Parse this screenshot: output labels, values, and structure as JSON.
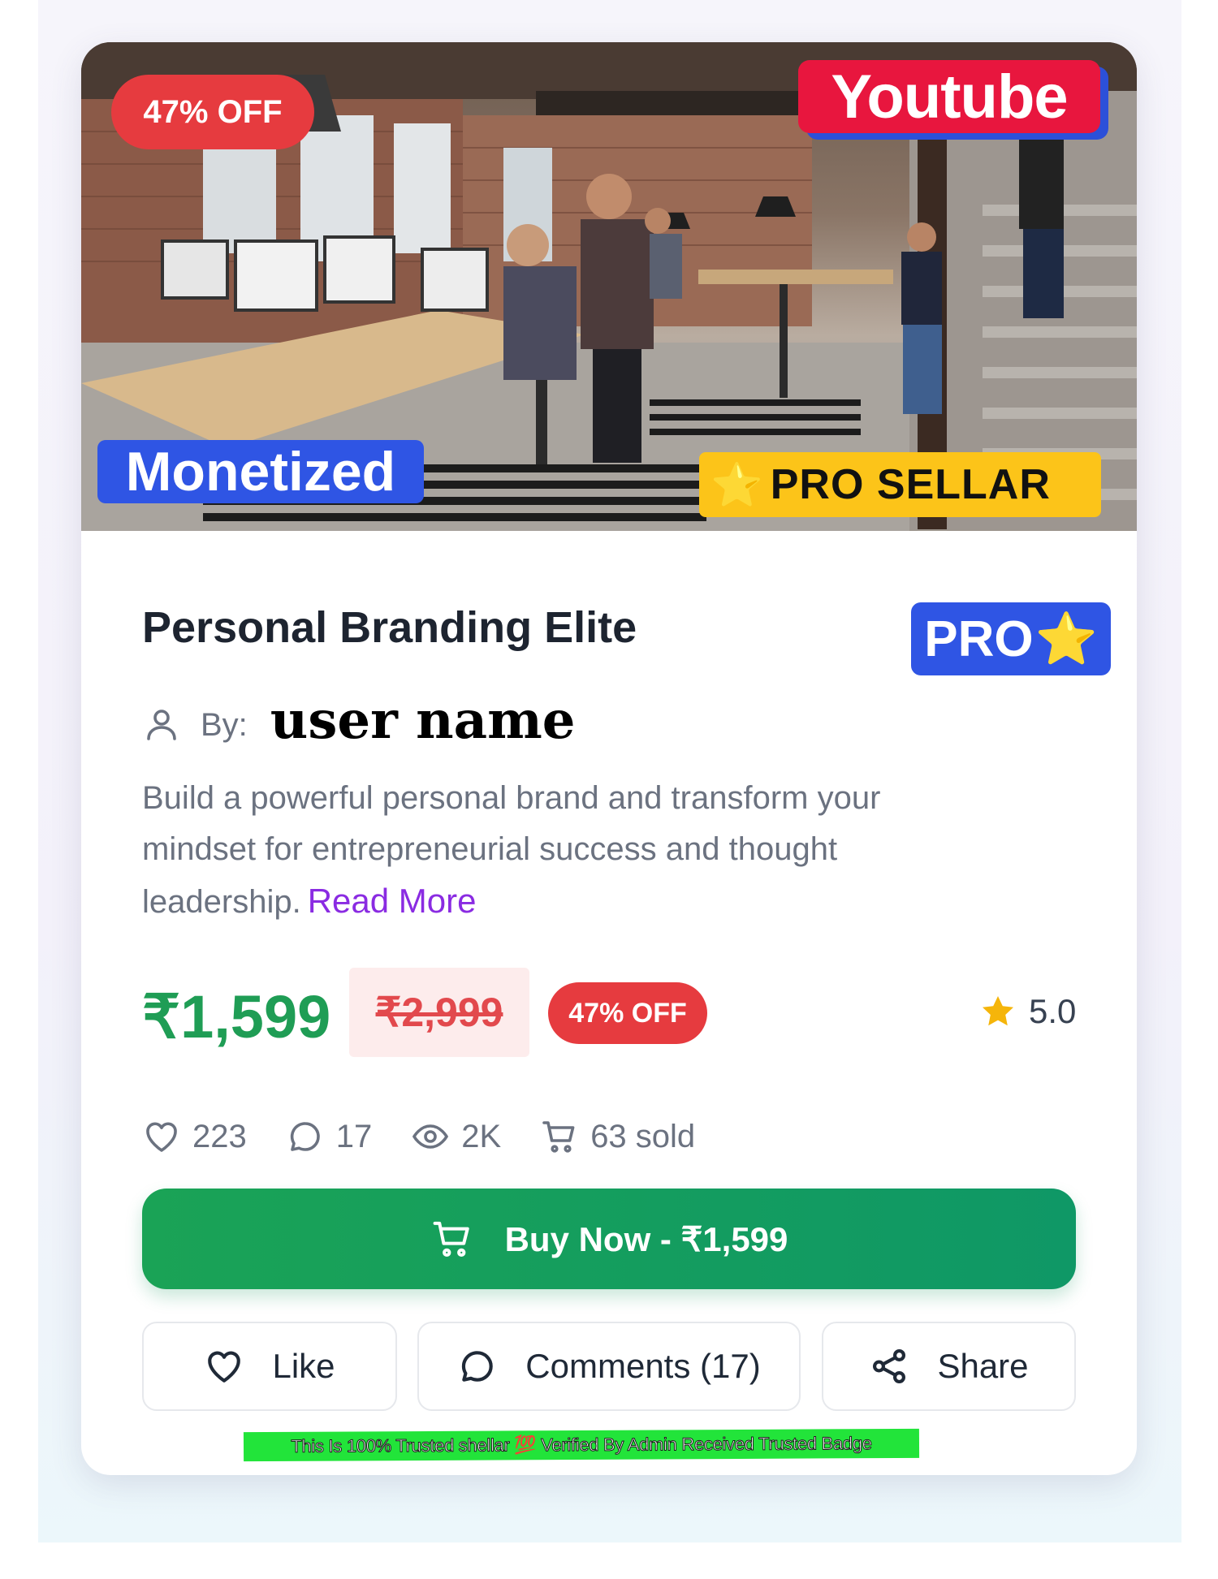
{
  "hero": {
    "discount_badge": "47% OFF",
    "youtube_badge": "Youtube",
    "monetized_badge": "Monetized",
    "pro_seller_star": "⭐",
    "pro_seller_badge": "PRO SELLAR"
  },
  "product": {
    "title": "Personal Branding Elite",
    "pro_badge": "PRO",
    "pro_badge_star": "⭐",
    "by_label": "By:",
    "author": "user name",
    "description": "Build a powerful personal brand and transform your mindset for entrepreneurial success and thought leadership.",
    "read_more": "Read More"
  },
  "pricing": {
    "current_price": "₹1,599",
    "original_price": "₹2,999",
    "discount": "47% OFF",
    "rating": "5.0"
  },
  "stats": {
    "likes": "223",
    "comments": "17",
    "views": "2K",
    "sold": "63 sold"
  },
  "actions": {
    "buy_now": "Buy Now - ₹1,599",
    "like": "Like",
    "comments": "Comments (17)",
    "share": "Share"
  },
  "trust_note": "This Is 100% Trusted shellar 💯 Verified By Admin Received Trusted Badge",
  "colors": {
    "price_green": "#1f9d55",
    "discount_red": "#e63b3f",
    "badge_blue": "#2f55e4",
    "youtube_red": "#e8163e",
    "pro_seller_yellow": "#fcc419",
    "read_more_purple": "#8a2be2",
    "trust_green": "#22e43a"
  },
  "icons": {
    "author": "user-icon",
    "likes": "heart-icon",
    "comments": "comment-icon",
    "views": "eye-icon",
    "sold": "cart-icon",
    "rating": "star-icon",
    "share": "share-icon"
  }
}
